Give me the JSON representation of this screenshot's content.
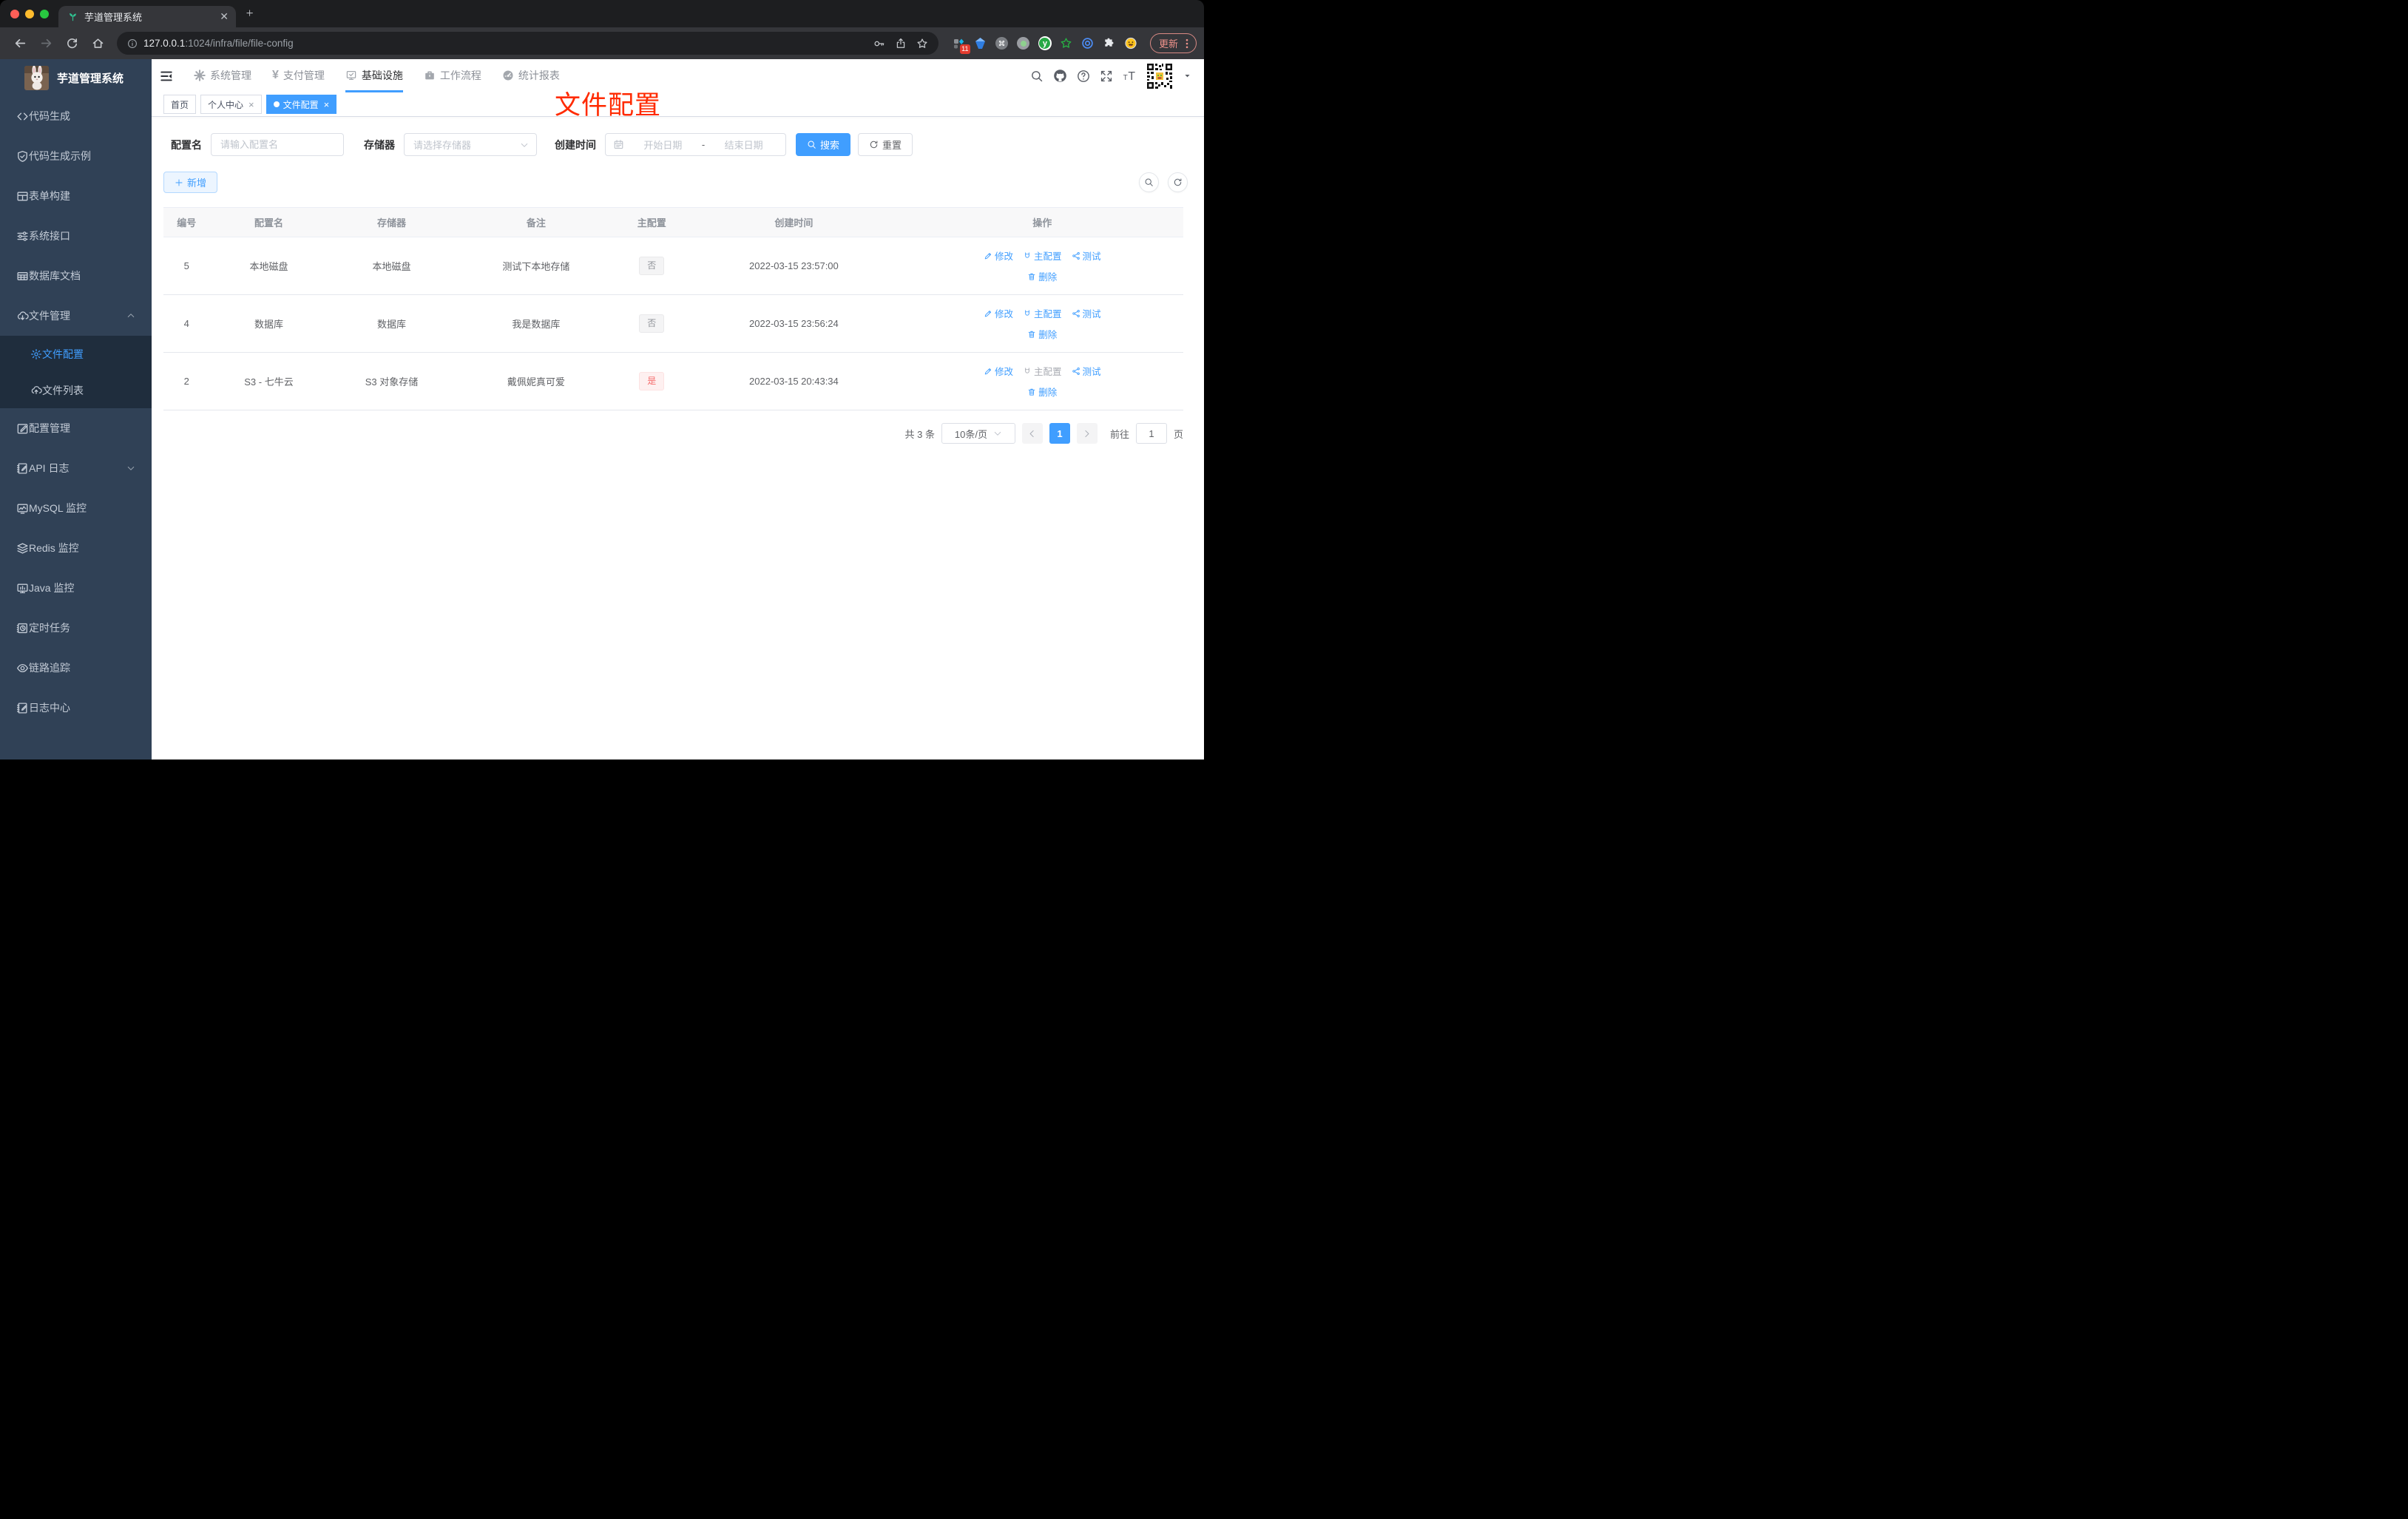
{
  "colors": {
    "accent": "#409eff",
    "danger": "#f56c6c",
    "annotation_red": "#ff2a00",
    "sidebar_bg": "#304156"
  },
  "browser": {
    "tab_title": "芋道管理系统",
    "url_host": "127.0.0.1",
    "url_rest": ":1024/infra/file/file-config",
    "update_label": "更新",
    "extensions": [
      {
        "name": "extension-generic-icon",
        "badge": "11"
      },
      {
        "name": "gem-icon"
      },
      {
        "name": "command-icon"
      },
      {
        "name": "grey-dot-icon"
      },
      {
        "name": "y-circle-icon"
      },
      {
        "name": "green-star-icon"
      },
      {
        "name": "blue-eye-icon"
      },
      {
        "name": "puzzle-icon"
      },
      {
        "name": "smiley-icon"
      }
    ]
  },
  "sidebar": {
    "logo_title": "芋道管理系统",
    "items": [
      {
        "icon": "code-icon",
        "label": "代码生成"
      },
      {
        "icon": "shield-check-icon",
        "label": "代码生成示例"
      },
      {
        "icon": "form-icon",
        "label": "表单构建"
      },
      {
        "icon": "sliders-icon",
        "label": "系统接口"
      },
      {
        "icon": "db-grid-icon",
        "label": "数据库文档"
      },
      {
        "icon": "cloud-down-icon",
        "label": "文件管理",
        "chevron": "up",
        "children": [
          {
            "icon": "gear-icon",
            "label": "文件配置",
            "active": true
          },
          {
            "icon": "cloud-up-icon",
            "label": "文件列表"
          }
        ]
      },
      {
        "icon": "edit-square-icon",
        "label": "配置管理"
      },
      {
        "icon": "doc-edit-icon",
        "label": "API 日志",
        "chevron": "down"
      },
      {
        "icon": "chart-monitor-icon",
        "label": "MySQL 监控"
      },
      {
        "icon": "layers-icon",
        "label": "Redis 监控"
      },
      {
        "icon": "monitor-icon",
        "label": "Java 监控"
      },
      {
        "icon": "timer-book-icon",
        "label": "定时任务"
      },
      {
        "icon": "eye-icon",
        "label": "链路追踪"
      },
      {
        "icon": "doc-edit-icon",
        "label": "日志中心"
      }
    ]
  },
  "navbar": {
    "menus": [
      {
        "icon": "gear-filled-icon",
        "label": "系统管理"
      },
      {
        "icon": "yen-icon",
        "label": "支付管理"
      },
      {
        "icon": "monitor-check-icon",
        "label": "基础设施",
        "active": true
      },
      {
        "icon": "briefcase-icon",
        "label": "工作流程"
      },
      {
        "icon": "gauge-icon",
        "label": "统计报表"
      }
    ]
  },
  "tags": [
    {
      "label": "首页",
      "closable": false,
      "active": false
    },
    {
      "label": "个人中心",
      "closable": true,
      "active": false
    },
    {
      "label": "文件配置",
      "closable": true,
      "active": true
    }
  ],
  "annotation": "文件配置",
  "filters": {
    "name_label": "配置名",
    "name_placeholder": "请输入配置名",
    "storage_label": "存储器",
    "storage_placeholder": "请选择存储器",
    "time_label": "创建时间",
    "start_placeholder": "开始日期",
    "separator": "-",
    "end_placeholder": "结束日期",
    "search_label": "搜索",
    "reset_label": "重置"
  },
  "toolbar": {
    "add_label": "新增"
  },
  "table": {
    "columns": [
      "编号",
      "配置名",
      "存储器",
      "备注",
      "主配置",
      "创建时间",
      "操作"
    ],
    "action_labels": {
      "edit": "修改",
      "master": "主配置",
      "test": "测试",
      "delete": "删除"
    },
    "rows": [
      {
        "id": "5",
        "name": "本地磁盘",
        "storage": "本地磁盘",
        "remark": "测试下本地存储",
        "master": "否",
        "master_type": "info",
        "master_disabled": false,
        "created": "2022-03-15 23:57:00"
      },
      {
        "id": "4",
        "name": "数据库",
        "storage": "数据库",
        "remark": "我是数据库",
        "master": "否",
        "master_type": "info",
        "master_disabled": false,
        "created": "2022-03-15 23:56:24"
      },
      {
        "id": "2",
        "name": "S3 - 七牛云",
        "storage": "S3 对象存储",
        "remark": "戴佩妮真可爱",
        "master": "是",
        "master_type": "danger",
        "master_disabled": true,
        "created": "2022-03-15 20:43:34"
      }
    ]
  },
  "pagination": {
    "total_text": "共 3 条",
    "page_size": "10条/页",
    "current_page": "1",
    "goto_label": "前往",
    "goto_value": "1",
    "page_suffix": "页"
  }
}
